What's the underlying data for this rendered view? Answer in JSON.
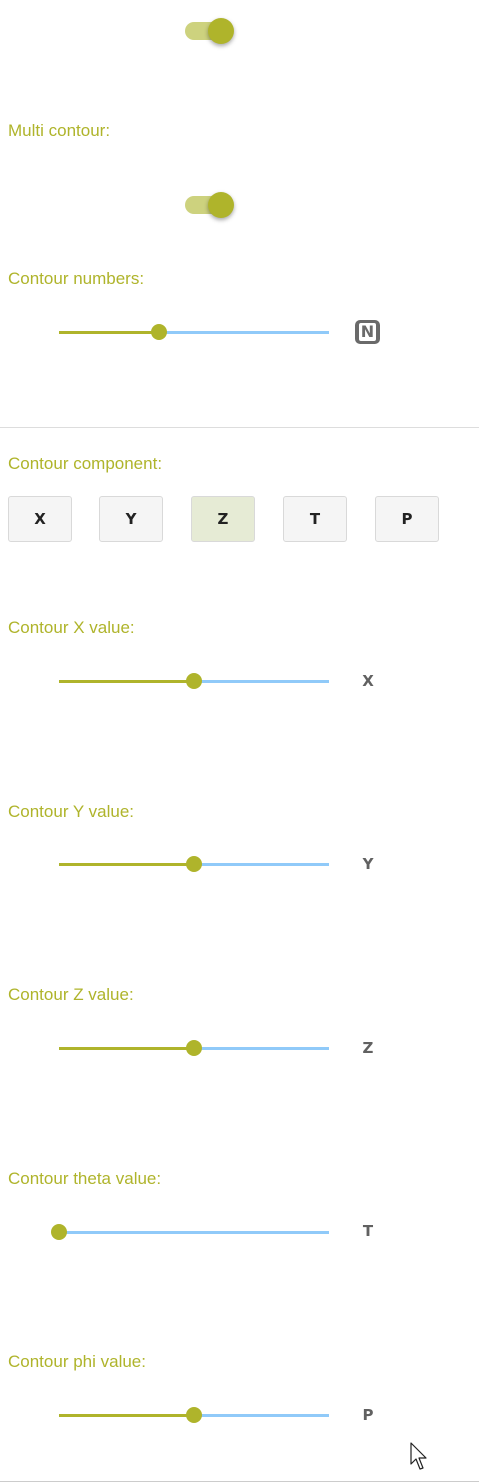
{
  "toggles": {
    "contour_toggle": {
      "on": true
    },
    "multi_contour": {
      "label": "Multi contour:",
      "on": true
    }
  },
  "contour_numbers": {
    "label": "Contour numbers:",
    "value": 0.37,
    "icon": "n-badge-icon"
  },
  "contour_component": {
    "label": "Contour component:",
    "options": [
      "X",
      "Y",
      "Z",
      "T",
      "P"
    ],
    "selected": "Z"
  },
  "sliders": [
    {
      "label": "Contour X value:",
      "end_label": "X",
      "value": 0.5
    },
    {
      "label": "Contour Y value:",
      "end_label": "Y",
      "value": 0.5
    },
    {
      "label": "Contour Z value:",
      "end_label": "Z",
      "value": 0.5
    },
    {
      "label": "Contour theta value:",
      "end_label": "T",
      "value": 0.0
    },
    {
      "label": "Contour phi value:",
      "end_label": "P",
      "value": 0.5
    }
  ],
  "colors": {
    "accent": "#afb42b",
    "rail": "#90caf9",
    "selected_button": "#e6ebd5"
  },
  "icons": {
    "cursor": "mouse-pointer-icon"
  }
}
